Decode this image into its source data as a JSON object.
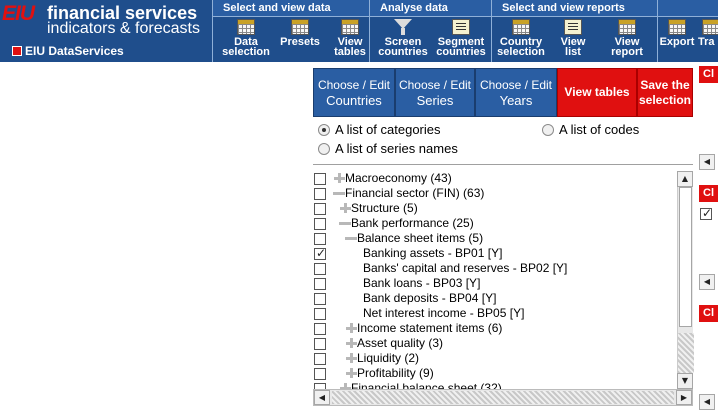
{
  "header": {
    "logo_eiu": "EIU",
    "logo_line1": "financial services",
    "logo_line2": "indicators & forecasts",
    "dataservices": "EIU DataServices",
    "groups": [
      {
        "title": "Select and view data"
      },
      {
        "title": "Analyse data"
      },
      {
        "title": "Select and view reports"
      }
    ],
    "tools": {
      "data_selection": [
        "Data",
        "selection"
      ],
      "presets": [
        "Presets",
        ""
      ],
      "view_tables": [
        "View",
        "tables"
      ],
      "screen_countries": [
        "Screen",
        "countries"
      ],
      "segment_countries": [
        "Segment",
        "countries"
      ],
      "country_selection": [
        "Country",
        "selection"
      ],
      "view_list": [
        "View",
        "list"
      ],
      "view_report": [
        "View",
        "report"
      ],
      "export": [
        "Export",
        ""
      ],
      "tra": [
        "Tra",
        ""
      ]
    }
  },
  "nav": {
    "countries": [
      "Choose / Edit",
      "Countries"
    ],
    "series": [
      "Choose / Edit",
      "Series"
    ],
    "years": [
      "Choose / Edit",
      "Years"
    ],
    "view_tables": "View tables",
    "save": [
      "Save the",
      "selection"
    ]
  },
  "radios": {
    "categories": "A list of categories",
    "codes": "A list of codes",
    "series_names": "A list of series names",
    "selected": "categories"
  },
  "tree": [
    {
      "label": "Macroeconomy (43)",
      "level": 0,
      "expander": "plus",
      "checked": false
    },
    {
      "label": "Financial sector (FIN) (63)",
      "level": 0,
      "expander": "minus",
      "checked": false
    },
    {
      "label": "Structure (5)",
      "level": 1,
      "expander": "plus",
      "checked": false
    },
    {
      "label": "Bank performance (25)",
      "level": 1,
      "expander": "minus",
      "checked": false
    },
    {
      "label": "Balance sheet items (5)",
      "level": 2,
      "expander": "minus",
      "checked": false
    },
    {
      "label": "Banking assets - BP01 [Y]",
      "level": 3,
      "expander": "none",
      "checked": true
    },
    {
      "label": "Banks' capital and reserves - BP02 [Y]",
      "level": 3,
      "expander": "none",
      "checked": false
    },
    {
      "label": "Bank loans - BP03 [Y]",
      "level": 3,
      "expander": "none",
      "checked": false
    },
    {
      "label": "Bank deposits - BP04 [Y]",
      "level": 3,
      "expander": "none",
      "checked": false
    },
    {
      "label": "Net interest income - BP05 [Y]",
      "level": 3,
      "expander": "none",
      "checked": false
    },
    {
      "label": "Income statement items (6)",
      "level": 2,
      "expander": "plus",
      "checked": false
    },
    {
      "label": "Asset quality (3)",
      "level": 2,
      "expander": "plus",
      "checked": false
    },
    {
      "label": "Liquidity (2)",
      "level": 2,
      "expander": "plus",
      "checked": false
    },
    {
      "label": "Profitability (9)",
      "level": 2,
      "expander": "plus",
      "checked": false
    },
    {
      "label": "Financial balance sheet (32)",
      "level": 1,
      "expander": "plus",
      "checked": false
    }
  ],
  "right_strip": {
    "clear_label": "Cl"
  },
  "colors": {
    "header_blue": "#1f4e8c",
    "nav_blue": "#2a5ea3",
    "accent_red": "#e01010"
  }
}
